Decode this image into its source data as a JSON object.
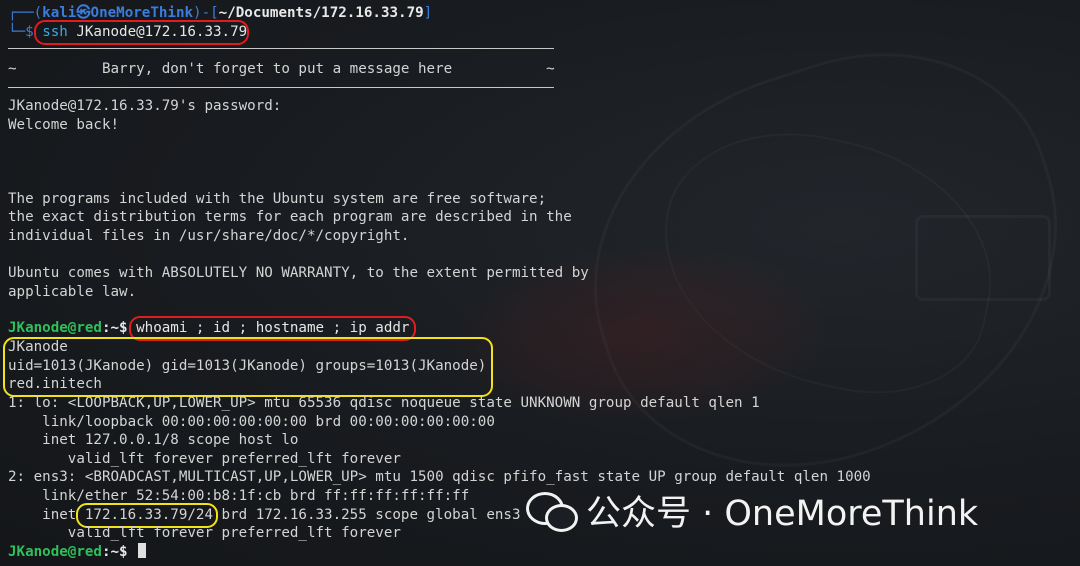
{
  "prompt1": {
    "prefix": "┌──(",
    "user": "kali",
    "at": "㉿",
    "host": "OneMoreThink",
    "mid": ")-[",
    "path": "~/Documents/172.16.33.79",
    "suffix": "]",
    "line2_prefix": "└─",
    "dollar": "$",
    "cmd_ssh": "ssh",
    "cmd_target": " JKanode@172.16.33.79"
  },
  "banner": {
    "text": "~          Barry, don't forget to put a message here           ~"
  },
  "login": {
    "password_prompt": "JKanode@172.16.33.79's password:",
    "welcome": "Welcome back!"
  },
  "motd": [
    "The programs included with the Ubuntu system are free software;",
    "the exact distribution terms for each program are described in the",
    "individual files in /usr/share/doc/*/copyright.",
    "",
    "Ubuntu comes with ABSOLUTELY NO WARRANTY, to the extent permitted by",
    "applicable law."
  ],
  "prompt2": {
    "user_host": "JKanode@red",
    "sep": ":~$ ",
    "command": "whoami ; id ; hostname ; ip addr"
  },
  "output": {
    "whoami": "JKanode",
    "id": "uid=1013(JKanode) gid=1013(JKanode) groups=1013(JKanode)",
    "hostname": "red.initech",
    "ip_lines": [
      "1: lo: <LOOPBACK,UP,LOWER_UP> mtu 65536 qdisc noqueue state UNKNOWN group default qlen 1",
      "    link/loopback 00:00:00:00:00:00 brd 00:00:00:00:00:00",
      "    inet 127.0.0.1/8 scope host lo",
      "       valid_lft forever preferred_lft forever",
      "2: ens3: <BROADCAST,MULTICAST,UP,LOWER_UP> mtu 1500 qdisc pfifo_fast state UP group default qlen 1000",
      "    link/ether 52:54:00:b8:1f:cb brd ff:ff:ff:ff:ff:ff"
    ],
    "inet_prefix": "    inet ",
    "inet_addr": "172.16.33.79/24",
    "inet_suffix": " brd 172.16.33.255 scope global ens3",
    "last_line": "       valid_lft forever preferred_lft forever"
  },
  "prompt3": {
    "user_host": "JKanode@red",
    "sep": ":~$ "
  },
  "watermark": {
    "text": "公众号 · OneMoreThink",
    "icon": "wechat-icon"
  },
  "colors": {
    "background": "#16191d",
    "prompt_blue": "#3b7ddd",
    "prompt_green": "#2fbf5b",
    "highlight_red": "#e21c1c",
    "highlight_yellow": "#f2e21a"
  }
}
